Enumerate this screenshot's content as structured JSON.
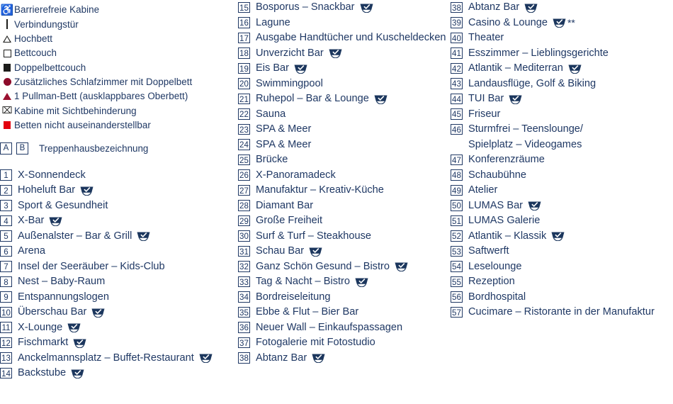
{
  "legend": {
    "items": [
      {
        "symbol": "wheelchair-icon",
        "label": "Barrierefreie Kabine"
      },
      {
        "symbol": "connecting-door-icon",
        "label": "Verbindungstür"
      },
      {
        "symbol": "open-triangle-icon",
        "label": "Hochbett"
      },
      {
        "symbol": "open-square-icon",
        "label": "Bettcouch"
      },
      {
        "symbol": "filled-square-icon",
        "label": "Doppelbettcouch"
      },
      {
        "symbol": "dark-red-circle-icon",
        "label": "Zusätzliches Schlafzimmer mit Doppelbett"
      },
      {
        "symbol": "dark-red-triangle-icon",
        "label": "1 Pullman-Bett (ausklappbares Oberbett)"
      },
      {
        "symbol": "obstructed-view-icon",
        "label": "Kabine mit Sichtbehinderung"
      },
      {
        "symbol": "red-square-icon",
        "label": "Betten nicht auseinanderstellbar"
      }
    ],
    "staircase": {
      "letters": [
        "A",
        "B"
      ],
      "label": "Treppenhausbezeichnung"
    }
  },
  "colors": {
    "text_navy": "#1f3864",
    "badge_navy": "#1b365d",
    "dark_red": "#8c0b2a",
    "bright_red": "#e3000f",
    "black": "#1d1d1b"
  },
  "columns": [
    {
      "id": "column-1",
      "items": [
        {
          "num": "1",
          "label": "X-Sonnendeck",
          "badge": false,
          "stars": ""
        },
        {
          "num": "2",
          "label": "Hoheluft Bar",
          "badge": true,
          "stars": ""
        },
        {
          "num": "3",
          "label": "Sport & Gesundheit",
          "badge": false,
          "stars": ""
        },
        {
          "num": "4",
          "label": "X-Bar",
          "badge": true,
          "stars": ""
        },
        {
          "num": "5",
          "label": "Außenalster – Bar & Grill",
          "badge": true,
          "stars": ""
        },
        {
          "num": "6",
          "label": "Arena",
          "badge": false,
          "stars": ""
        },
        {
          "num": "7",
          "label": "Insel der Seeräuber – Kids-Club",
          "badge": false,
          "stars": ""
        },
        {
          "num": "8",
          "label": "Nest – Baby-Raum",
          "badge": false,
          "stars": ""
        },
        {
          "num": "9",
          "label": "Entspannungslogen",
          "badge": false,
          "stars": ""
        },
        {
          "num": "10",
          "label": "Überschau Bar",
          "badge": true,
          "stars": ""
        },
        {
          "num": "11",
          "label": "X-Lounge",
          "badge": true,
          "stars": ""
        },
        {
          "num": "12",
          "label": "Fischmarkt",
          "badge": true,
          "stars": ""
        },
        {
          "num": "13",
          "label": "Anckelmannsplatz – Buffet-Restaurant",
          "badge": true,
          "stars": ""
        },
        {
          "num": "14",
          "label": "Backstube",
          "badge": true,
          "stars": ""
        }
      ]
    },
    {
      "id": "column-2",
      "items": [
        {
          "num": "15",
          "label": "Bosporus – Snackbar",
          "badge": true,
          "stars": ""
        },
        {
          "num": "16",
          "label": "Lagune",
          "badge": false,
          "stars": ""
        },
        {
          "num": "17",
          "label": "Ausgabe Handtücher und Kuscheldecken",
          "badge": false,
          "stars": ""
        },
        {
          "num": "18",
          "label": "Unverzicht Bar",
          "badge": true,
          "stars": ""
        },
        {
          "num": "19",
          "label": "Eis Bar",
          "badge": true,
          "stars": ""
        },
        {
          "num": "20",
          "label": "Swimmingpool",
          "badge": false,
          "stars": ""
        },
        {
          "num": "21",
          "label": "Ruhepol – Bar & Lounge",
          "badge": true,
          "stars": ""
        },
        {
          "num": "22",
          "label": "Sauna",
          "badge": false,
          "stars": ""
        },
        {
          "num": "23",
          "label": "SPA & Meer",
          "badge": false,
          "stars": ""
        },
        {
          "num": "24",
          "label": "SPA & Meer",
          "badge": false,
          "stars": ""
        },
        {
          "num": "25",
          "label": "Brücke",
          "badge": false,
          "stars": ""
        },
        {
          "num": "26",
          "label": "X-Panoramadeck",
          "badge": false,
          "stars": ""
        },
        {
          "num": "27",
          "label": "Manufaktur – Kreativ-Küche",
          "badge": false,
          "stars": ""
        },
        {
          "num": "28",
          "label": "Diamant Bar",
          "badge": false,
          "stars": ""
        },
        {
          "num": "29",
          "label": "Große Freiheit",
          "badge": false,
          "stars": ""
        },
        {
          "num": "30",
          "label": "Surf & Turf – Steakhouse",
          "badge": false,
          "stars": ""
        },
        {
          "num": "31",
          "label": "Schau Bar",
          "badge": true,
          "stars": ""
        },
        {
          "num": "32",
          "label": "Ganz Schön Gesund – Bistro",
          "badge": true,
          "stars": ""
        },
        {
          "num": "33",
          "label": "Tag & Nacht – Bistro",
          "badge": true,
          "stars": ""
        },
        {
          "num": "34",
          "label": "Bordreiseleitung",
          "badge": false,
          "stars": ""
        },
        {
          "num": "35",
          "label": "Ebbe & Flut – Bier Bar",
          "badge": false,
          "stars": ""
        },
        {
          "num": "36",
          "label": "Neuer Wall – Einkaufspassagen",
          "badge": false,
          "stars": ""
        },
        {
          "num": "37",
          "label": "Fotogalerie mit Fotostudio",
          "badge": false,
          "stars": ""
        },
        {
          "num": "38",
          "label": "Abtanz Bar",
          "badge": true,
          "stars": ""
        }
      ]
    },
    {
      "id": "column-3",
      "items": [
        {
          "num": "38",
          "label": "Abtanz Bar",
          "badge": true,
          "stars": ""
        },
        {
          "num": "39",
          "label": "Casino & Lounge",
          "badge": true,
          "stars": "**"
        },
        {
          "num": "40",
          "label": "Theater",
          "badge": false,
          "stars": ""
        },
        {
          "num": "41",
          "label": "Esszimmer – Lieblingsgerichte",
          "badge": false,
          "stars": ""
        },
        {
          "num": "42",
          "label": "Atlantik – Mediterran",
          "badge": true,
          "stars": ""
        },
        {
          "num": "43",
          "label": "Landausflüge, Golf & Biking",
          "badge": false,
          "stars": ""
        },
        {
          "num": "44",
          "label": "TUI Bar",
          "badge": true,
          "stars": ""
        },
        {
          "num": "45",
          "label": "Friseur",
          "badge": false,
          "stars": ""
        },
        {
          "num": "46",
          "label": "Sturmfrei – Teenslounge/",
          "badge": false,
          "stars": ""
        },
        {
          "num": "",
          "label": "Spielplatz – Videogames",
          "badge": false,
          "stars": "",
          "continuation": true
        },
        {
          "num": "47",
          "label": "Konferenzräume",
          "badge": false,
          "stars": ""
        },
        {
          "num": "48",
          "label": "Schaubühne",
          "badge": false,
          "stars": ""
        },
        {
          "num": "49",
          "label": "Atelier",
          "badge": false,
          "stars": ""
        },
        {
          "num": "50",
          "label": "LUMAS Bar",
          "badge": true,
          "stars": ""
        },
        {
          "num": "51",
          "label": "LUMAS Galerie",
          "badge": false,
          "stars": ""
        },
        {
          "num": "52",
          "label": "Atlantik – Klassik",
          "badge": true,
          "stars": ""
        },
        {
          "num": "53",
          "label": "Saftwerft",
          "badge": false,
          "stars": ""
        },
        {
          "num": "54",
          "label": "Leselounge",
          "badge": false,
          "stars": ""
        },
        {
          "num": "55",
          "label": "Rezeption",
          "badge": false,
          "stars": ""
        },
        {
          "num": "56",
          "label": "Bordhospital",
          "badge": false,
          "stars": ""
        },
        {
          "num": "57",
          "label": "Cucimare – Ristorante in der Manufaktur",
          "badge": false,
          "stars": ""
        }
      ]
    }
  ],
  "badge_icon_name": "included-ribbon-check-icon"
}
